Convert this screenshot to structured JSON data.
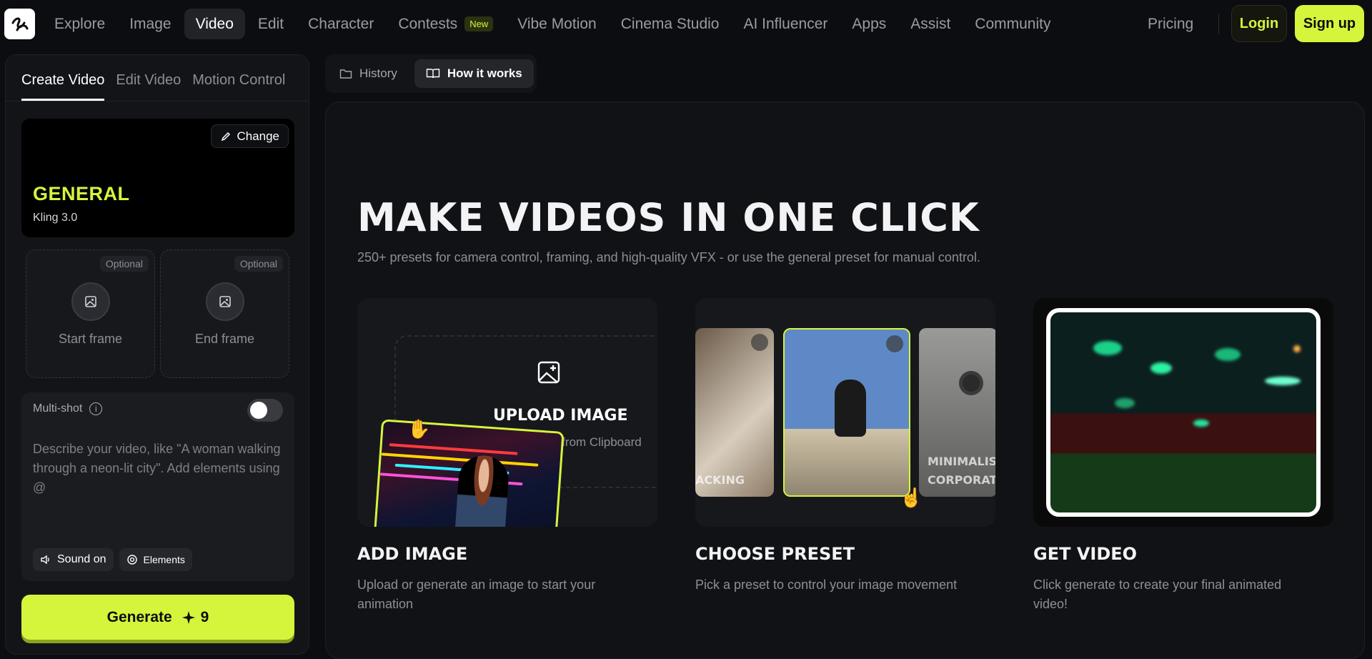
{
  "nav": {
    "items": [
      "Explore",
      "Image",
      "Video",
      "Edit",
      "Character",
      "Contests",
      "Vibe Motion",
      "Cinema Studio",
      "AI Influencer",
      "Apps",
      "Assist",
      "Community"
    ],
    "active": "Video",
    "new_badge": "New",
    "pricing": "Pricing",
    "login": "Login",
    "signup": "Sign up"
  },
  "left": {
    "tabs": [
      "Create Video",
      "Edit Video",
      "Motion Control"
    ],
    "model": {
      "change": "Change",
      "name": "GENERAL",
      "version": "Kling 3.0"
    },
    "frames": {
      "optional": "Optional",
      "start": "Start frame",
      "end": "End frame"
    },
    "multishot": "Multi-shot",
    "prompt_placeholder": "Describe your video, like \"A woman walking through a neon-lit city\". Add elements using @",
    "sound": "Sound on",
    "elements": "Elements",
    "generate": "Generate",
    "cost": "9"
  },
  "top_tabs": {
    "history": "History",
    "how": "How it works"
  },
  "hero": {
    "title": "MAKE VIDEOS IN ONE CLICK",
    "subtitle": "250+ presets for camera control, framing, and high-quality VFX - or use the general preset for manual control."
  },
  "steps": [
    {
      "title": "ADD IMAGE",
      "desc": "Upload or generate an image to start your animation"
    },
    {
      "title": "CHOOSE PRESET",
      "desc": "Pick a preset to control your image movement"
    },
    {
      "title": "GET VIDEO",
      "desc": "Click generate to create your final animated video!"
    }
  ],
  "card1": {
    "upload": "UPLOAD IMAGE",
    "paste": "Paste from Clipboard"
  },
  "card2": {
    "left_label": "ACKING",
    "right_label_1": "MINIMALISM",
    "right_label_2": "CORPORATE"
  },
  "colors": {
    "accent": "#d4f53c",
    "bg": "#0c0d10"
  }
}
